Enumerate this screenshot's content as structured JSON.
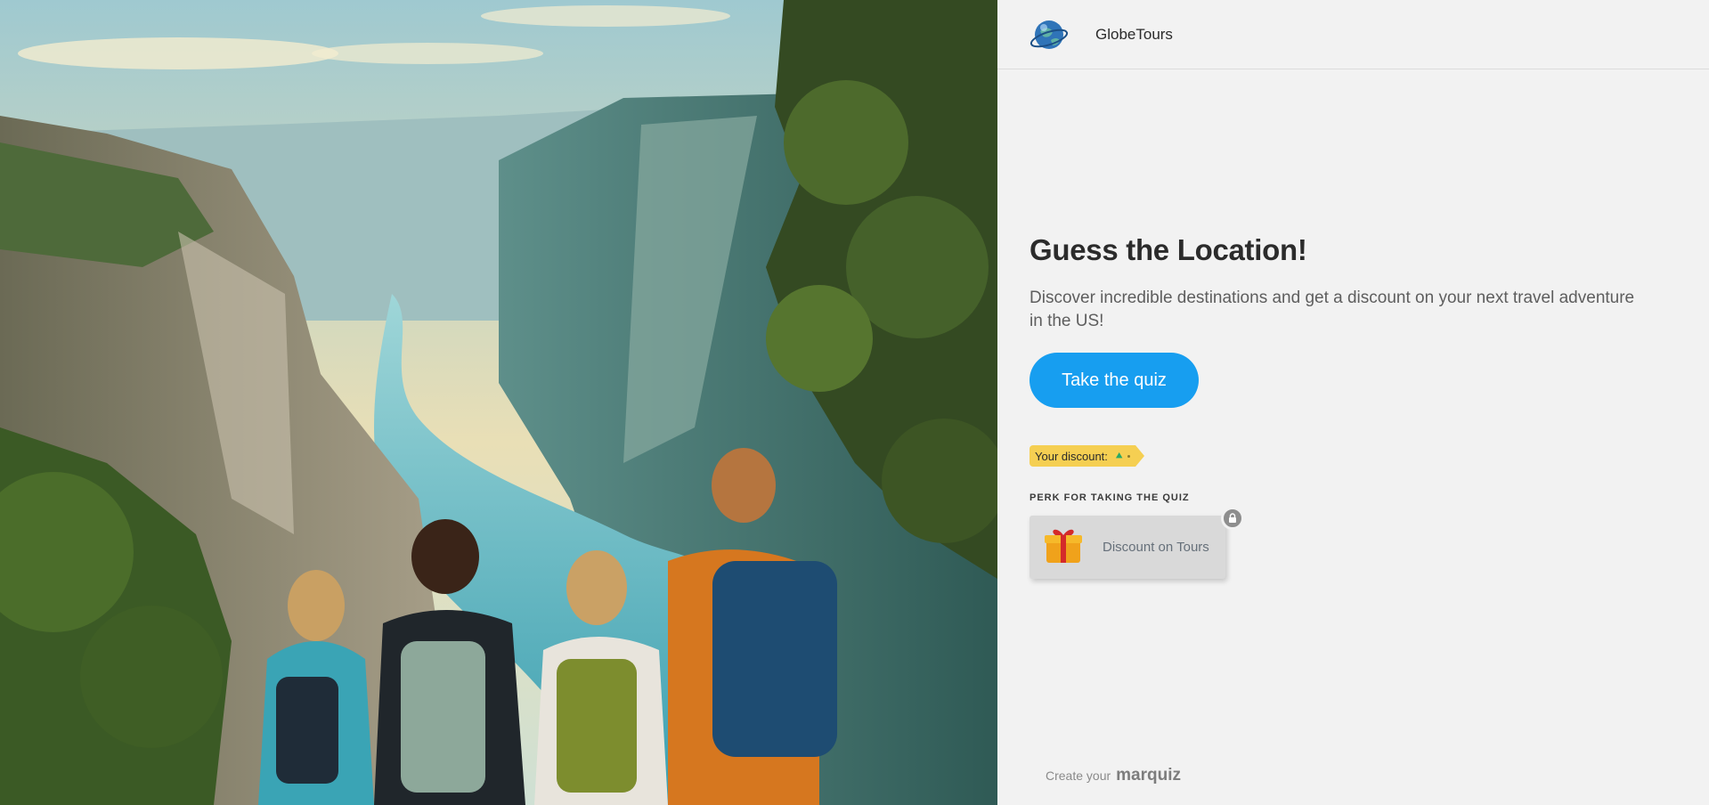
{
  "header": {
    "brand": "GlobeTours"
  },
  "main": {
    "title": "Guess the Location!",
    "subtitle": "Discover incredible destinations and get a discount on your next travel adventure in the US!",
    "cta_label": "Take the quiz"
  },
  "discount": {
    "label": "Your discount:"
  },
  "perk": {
    "section_label": "PERK FOR TAKING THE QUIZ",
    "card_label": "Discount on Tours"
  },
  "footer": {
    "prefix": "Create your",
    "brand": "marquiz"
  },
  "colors": {
    "accent": "#179ef0",
    "discount_tag": "#f5cf52",
    "panel_bg": "#f2f2f2"
  },
  "icons": [
    "globe-logo-icon",
    "gift-icon",
    "lock-icon",
    "chevron-up-icon"
  ]
}
